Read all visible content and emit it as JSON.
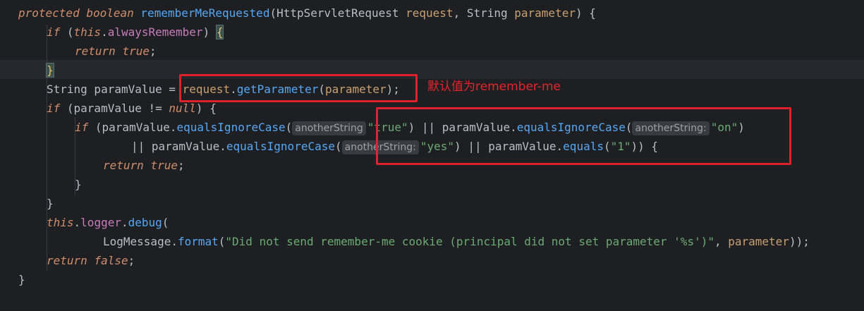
{
  "code": {
    "l1": {
      "protected": "protected",
      "boolean": "boolean",
      "method": "rememberMeRequested",
      "open": "(",
      "type1": "HttpServletRequest",
      "p1": "request",
      "comma": ", ",
      "type2": "String",
      "p2": "parameter",
      "close": ") {"
    },
    "l2": {
      "if": "if",
      "open": " (",
      "this": "this",
      "dot": ".",
      "field": "alwaysRemember",
      "close": ") ",
      "brace": "{"
    },
    "l3": {
      "return": "return",
      "val": "true",
      "semi": ";"
    },
    "l4": {
      "brace": "}"
    },
    "l5": {
      "type": "String",
      "var": " paramValue = ",
      "obj": "request",
      "dot": ".",
      "method": "getParameter",
      "open": "(",
      "arg": "parameter",
      "close": ");"
    },
    "l6": {
      "if": "if",
      "open": " (paramValue != ",
      "null": "null",
      "close": ") {"
    },
    "l7": {
      "if": "if",
      "open": " (paramValue.",
      "m1": "equalsIgnoreCase",
      "p": "(",
      "hint": "anotherString",
      "s1": "\"true\"",
      "mid": ") || paramValue.",
      "m2": "equalsIgnoreCase",
      "p2": "(",
      "hint2": "anotherString:",
      "s2": "\"on\"",
      "close": ")"
    },
    "l8": {
      "or": "|| paramValue.",
      "m1": "equalsIgnoreCase",
      "p": "(",
      "hint": "anotherString:",
      "s1": "\"yes\"",
      "mid": ") || paramValue.",
      "m2": "equals",
      "p2": "(",
      "s2": "\"1\"",
      "close": ")) {"
    },
    "l9": {
      "return": "return",
      "val": "true",
      "semi": ";"
    },
    "l10": {
      "brace": "}"
    },
    "l11": {
      "brace": "}"
    },
    "l12": {
      "this": "this",
      "dot": ".",
      "field": "logger",
      "dot2": ".",
      "method": "debug",
      "open": "("
    },
    "l13": {
      "cls": "LogMessage",
      "dot": ".",
      "method": "format",
      "open": "(",
      "str": "\"Did not send remember-me cookie (principal did not set parameter '%s')\"",
      "comma": ", ",
      "arg": "parameter",
      "close": "));"
    },
    "l14": {
      "return": "return",
      "val": "false",
      "semi": ";"
    },
    "l15": {
      "brace": "}"
    }
  },
  "annotation": {
    "note": "默认值为remember-me"
  },
  "colors": {
    "annotation_red": "#e0202a",
    "keyword": "#cf8e6d",
    "method": "#56a8f5",
    "field": "#c77dbb",
    "string": "#6aab73"
  }
}
